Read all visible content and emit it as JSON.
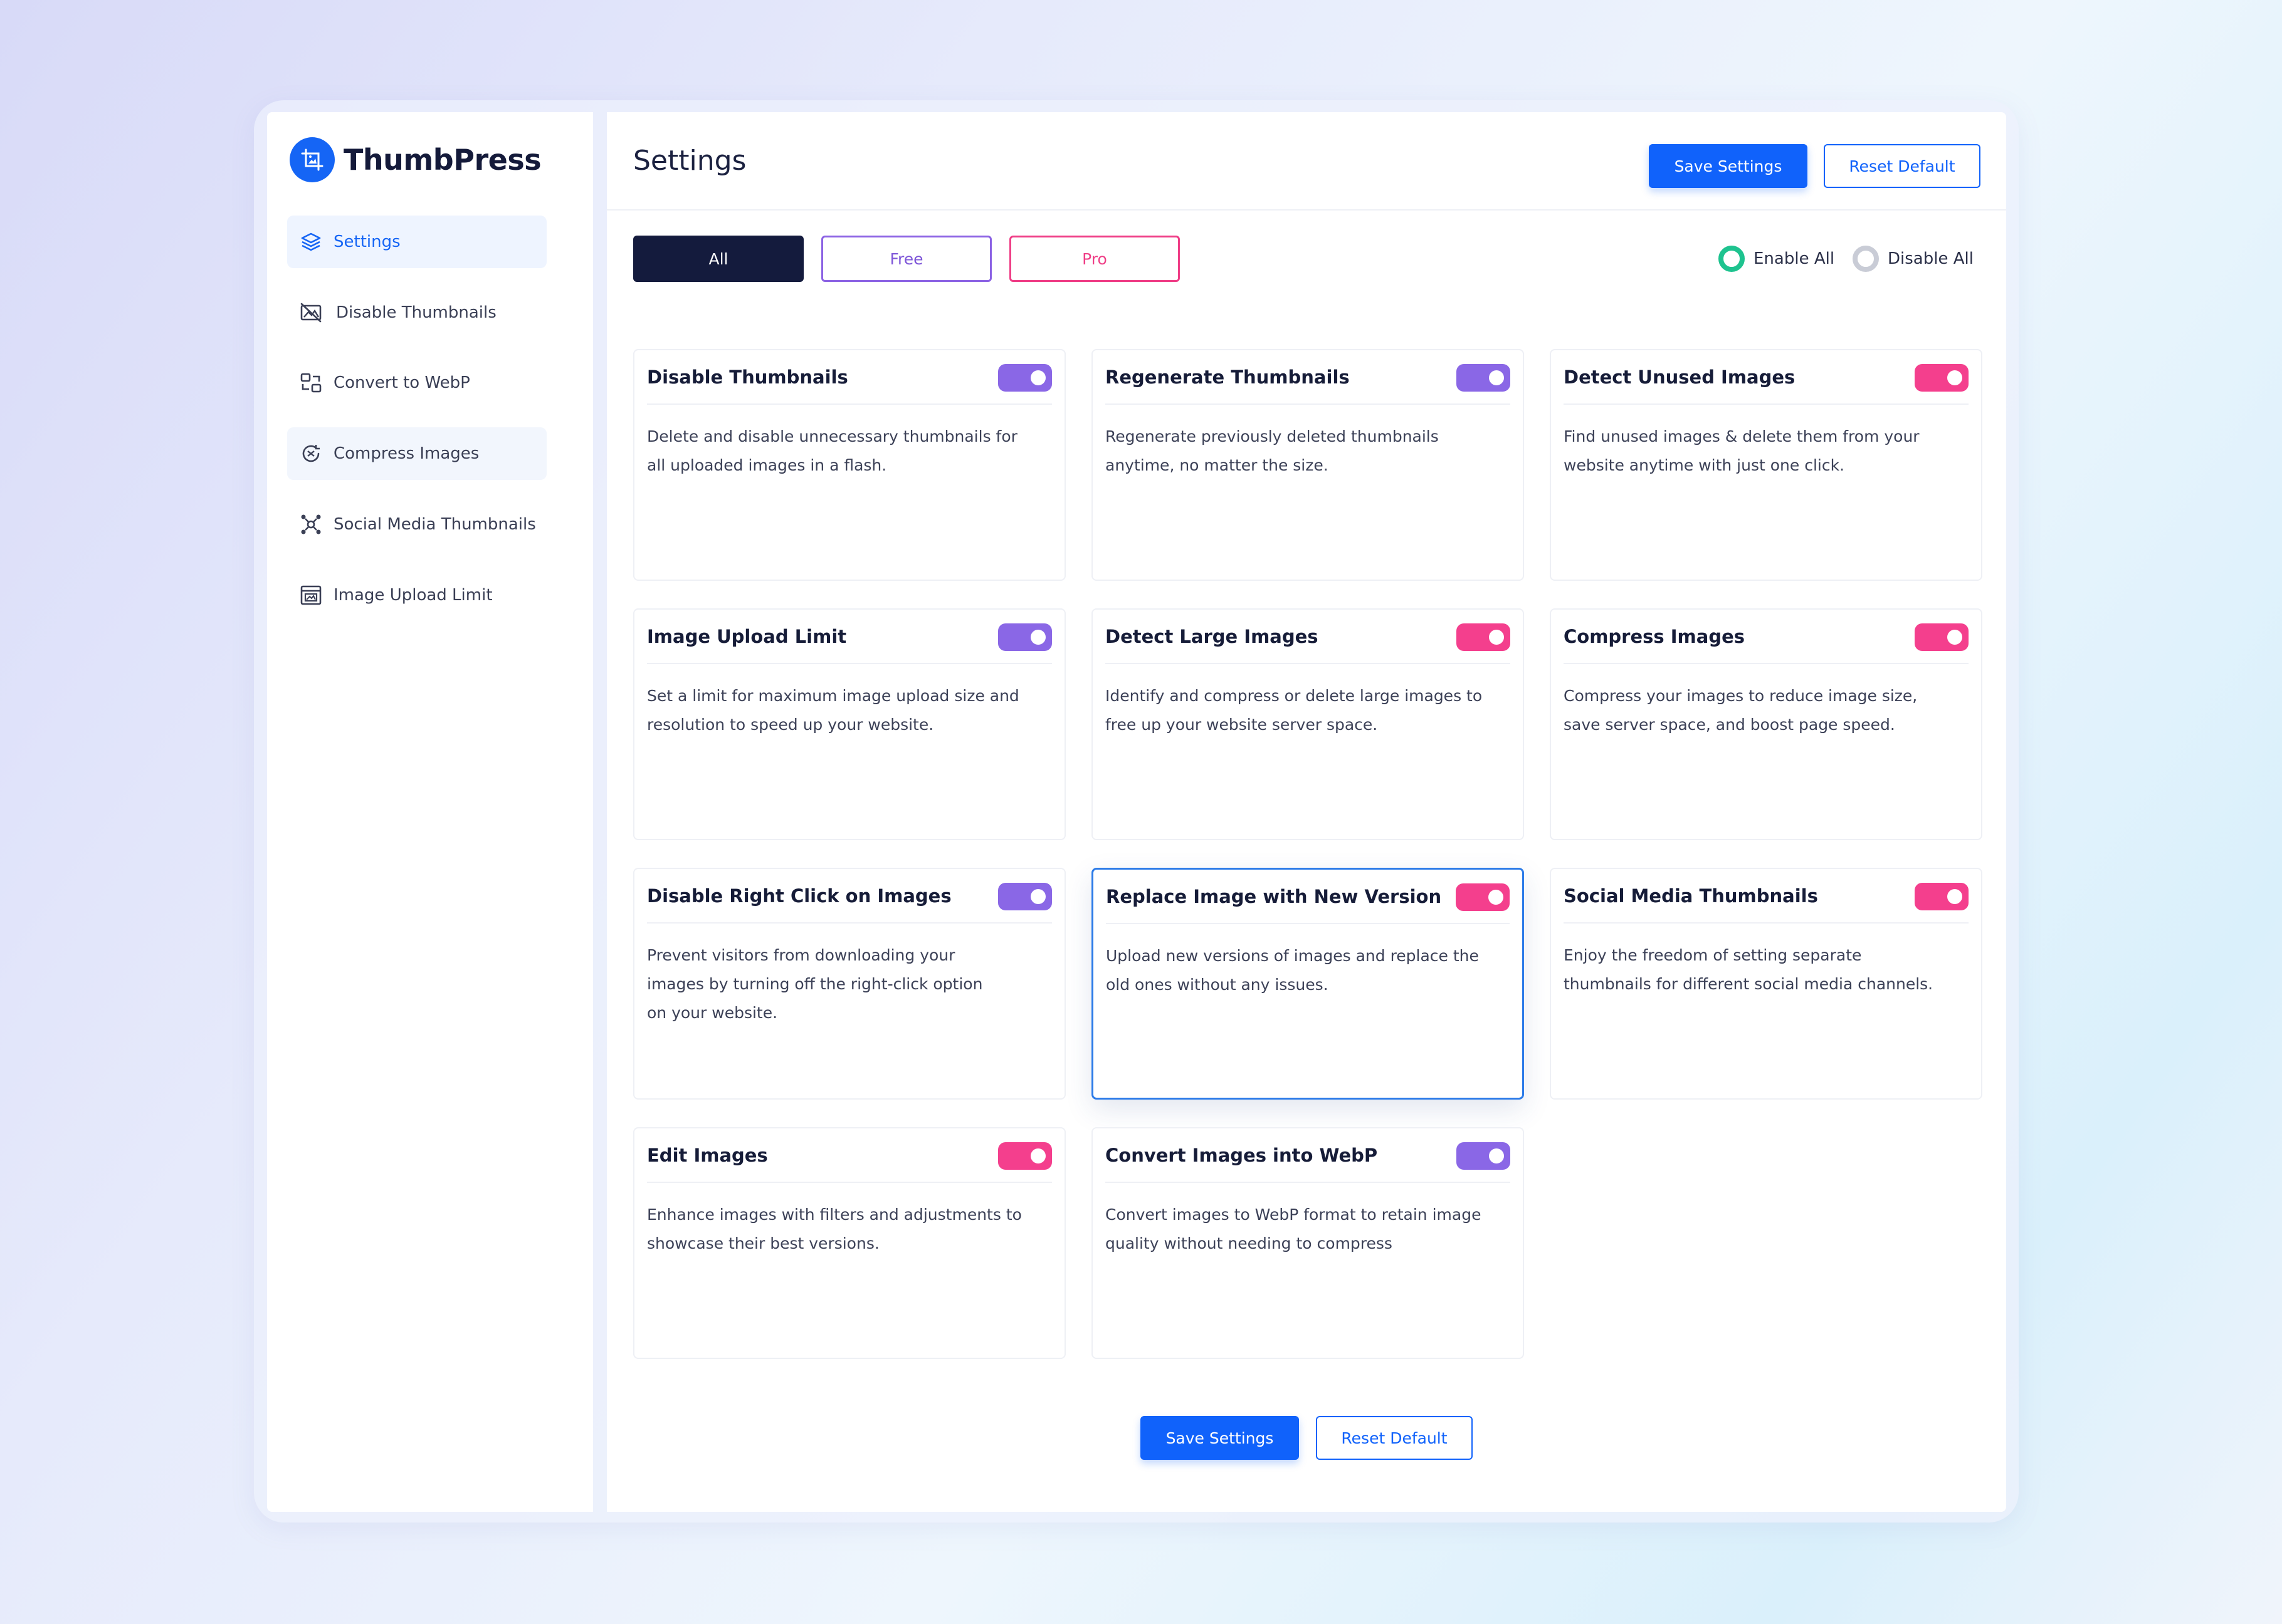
{
  "app": {
    "name": "ThumbPress"
  },
  "sidebar": {
    "items": [
      {
        "label": "Settings",
        "icon": "layers-icon",
        "active": true
      },
      {
        "label": "Disable Thumbnails",
        "icon": "image-off-icon"
      },
      {
        "label": "Convert to WebP",
        "icon": "convert-icon"
      },
      {
        "label": "Compress Images",
        "icon": "compress-icon",
        "highlighted": true
      },
      {
        "label": "Social Media Thumbnails",
        "icon": "share-nodes-icon"
      },
      {
        "label": "Image Upload Limit",
        "icon": "upload-limit-icon"
      }
    ]
  },
  "header": {
    "title": "Settings",
    "save_label": "Save Settings",
    "reset_label": "Reset Default"
  },
  "filters": {
    "all": "All",
    "free": "Free",
    "pro": "Pro",
    "selected": "All"
  },
  "bulk": {
    "enable_all": "Enable All",
    "disable_all": "Disable All",
    "selected": "Enable All"
  },
  "cards": [
    {
      "title": "Disable Thumbnails",
      "desc": "Delete and disable unnecessary thumbnails for all uploaded images in a flash.",
      "tier": "free",
      "enabled": true
    },
    {
      "title": "Regenerate Thumbnails",
      "desc": "Regenerate previously deleted thumbnails anytime, no matter the size.",
      "tier": "free",
      "enabled": true
    },
    {
      "title": "Detect Unused Images",
      "desc": "Find unused images & delete them from your website anytime with just one click.",
      "tier": "pro",
      "enabled": true
    },
    {
      "title": "Image Upload Limit",
      "desc": "Set a limit for maximum image upload size and resolution to speed up your website.",
      "tier": "free",
      "enabled": true
    },
    {
      "title": "Detect Large Images",
      "desc": "Identify and compress or delete large images to free up your website server space.",
      "tier": "pro",
      "enabled": true
    },
    {
      "title": "Compress Images",
      "desc": "Compress your images to reduce image size, save server space, and boost page speed.",
      "tier": "pro",
      "enabled": true
    },
    {
      "title": "Disable Right Click on Images",
      "desc": "Prevent visitors from downloading your images by turning off the right-click option on your website.",
      "tier": "free",
      "enabled": true
    },
    {
      "title": "Replace Image with New Version",
      "desc": "Upload new versions of images and replace the old ones without any issues.",
      "tier": "pro",
      "enabled": true
    },
    {
      "title": "Social Media Thumbnails",
      "desc": "Enjoy the freedom of setting separate thumbnails for different social media channels.",
      "tier": "pro",
      "enabled": true
    },
    {
      "title": "Edit Images",
      "desc": "Enhance images with filters and adjustments to showcase their best versions.",
      "tier": "pro",
      "enabled": true
    },
    {
      "title": "Convert Images into WebP",
      "desc": "Convert images to WebP format to retain image quality without needing to compress",
      "tier": "free",
      "enabled": true
    }
  ],
  "footer": {
    "save_label": "Save Settings",
    "reset_label": "Reset Default"
  },
  "colors": {
    "primary": "#1062fb",
    "free_toggle": "#8a67e6",
    "pro_toggle": "#f43f8d",
    "enable_radio": "#1ec38f",
    "dark_filter": "#141b3d"
  }
}
